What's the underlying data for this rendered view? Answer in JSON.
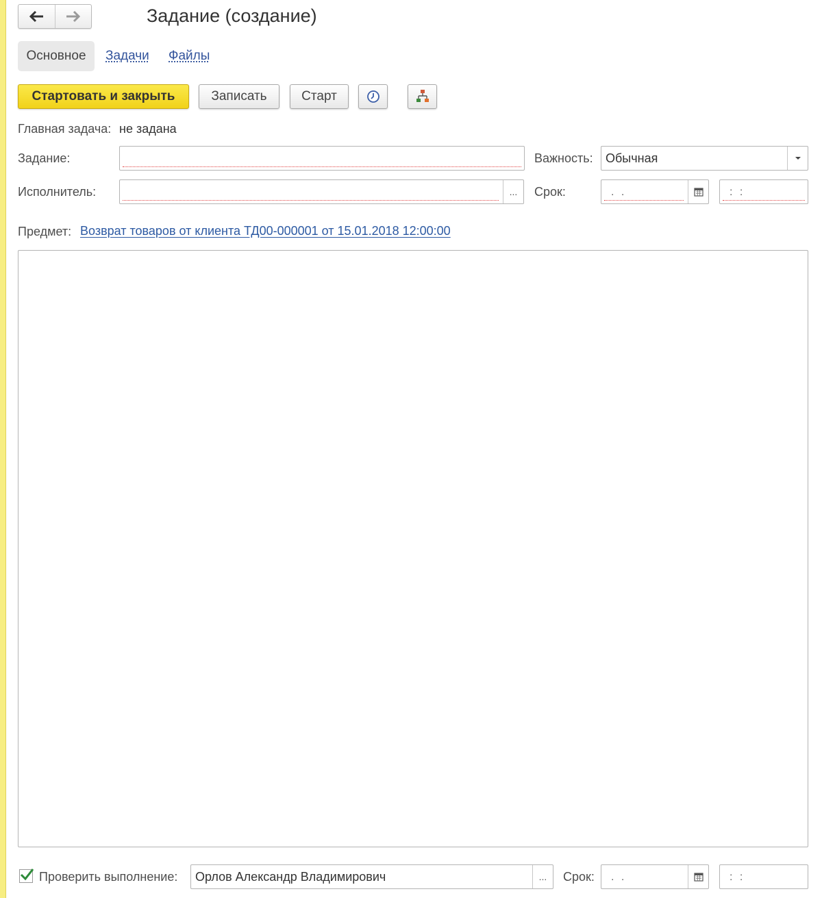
{
  "window": {
    "title": "Задание (создание)"
  },
  "nav": {
    "back_icon": "arrow-left-icon",
    "forward_icon": "arrow-right-icon"
  },
  "tabs": [
    {
      "label": "Основное",
      "active": true
    },
    {
      "label": "Задачи",
      "active": false
    },
    {
      "label": "Файлы",
      "active": false
    }
  ],
  "toolbar": {
    "start_close_label": "Стартовать и закрыть",
    "save_label": "Записать",
    "start_label": "Старт",
    "history_icon": "clock-icon",
    "structure_icon": "hierarchy-icon"
  },
  "main_task": {
    "label": "Главная задача:",
    "value": "не задана"
  },
  "task_field": {
    "label": "Задание:",
    "value": ""
  },
  "importance": {
    "label": "Важность:",
    "value": "Обычная"
  },
  "executor": {
    "label": "Исполнитель:",
    "value": "",
    "select_label": "..."
  },
  "deadline": {
    "label": "Срок:",
    "date_mask": ". .",
    "time_mask": ": :"
  },
  "subject": {
    "label": "Предмет:",
    "link": "Возврат товаров от клиента ТД00-000001 от 15.01.2018 12:00:00"
  },
  "description": {
    "value": ""
  },
  "check": {
    "checked": true,
    "label": "Проверить выполнение:",
    "value": "Орлов Александр Владимирович",
    "select_label": "...",
    "deadline_label": "Срок:",
    "date_mask": ". .",
    "time_mask": ": :"
  },
  "colors": {
    "primary_button": "#f5dc2a",
    "link": "#2d5aa3",
    "side_strip": "#f7ee82"
  }
}
